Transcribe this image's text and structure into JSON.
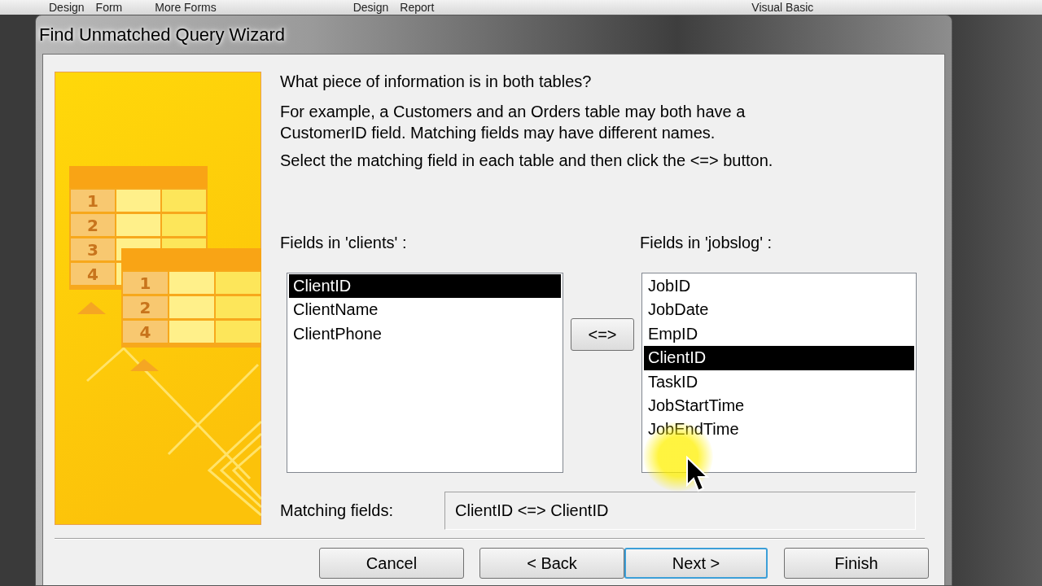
{
  "ribbon": {
    "labels": [
      "Design",
      "Form",
      "More Forms",
      "Design",
      "Report",
      "Visual Basic"
    ]
  },
  "window": {
    "title": "Find Unmatched Query Wizard"
  },
  "illustration": {
    "table_1_rows": [
      "1",
      "2",
      "3",
      "4"
    ],
    "table_2_rows": [
      "1",
      "2",
      "4"
    ]
  },
  "heading": "What piece of information is in both tables?",
  "description": "For example, a Customers and an Orders table may both have a CustomerID field. Matching fields may have different names.",
  "instruction": "Select the matching field in each table and then click the <=> button.",
  "left_list": {
    "label": "Fields in 'clients' :",
    "items": [
      {
        "text": "ClientID",
        "selected": true
      },
      {
        "text": "ClientName",
        "selected": false
      },
      {
        "text": "ClientPhone",
        "selected": false
      }
    ]
  },
  "match_button": "<=>",
  "right_list": {
    "label": "Fields in 'jobslog' :",
    "items": [
      {
        "text": "JobID",
        "selected": false
      },
      {
        "text": "JobDate",
        "selected": false
      },
      {
        "text": "EmpID",
        "selected": false
      },
      {
        "text": "ClientID",
        "selected": true
      },
      {
        "text": "TaskID",
        "selected": false
      },
      {
        "text": "JobStartTime",
        "selected": false
      },
      {
        "text": "JobEndTime",
        "selected": false
      }
    ]
  },
  "matching_fields": {
    "label": "Matching fields:",
    "value": "ClientID <=> ClientID"
  },
  "buttons": [
    {
      "label": "Cancel",
      "default": false
    },
    {
      "label": "< Back",
      "default": false
    },
    {
      "label": "Next >",
      "default": true
    },
    {
      "label": "Finish",
      "default": false
    }
  ]
}
